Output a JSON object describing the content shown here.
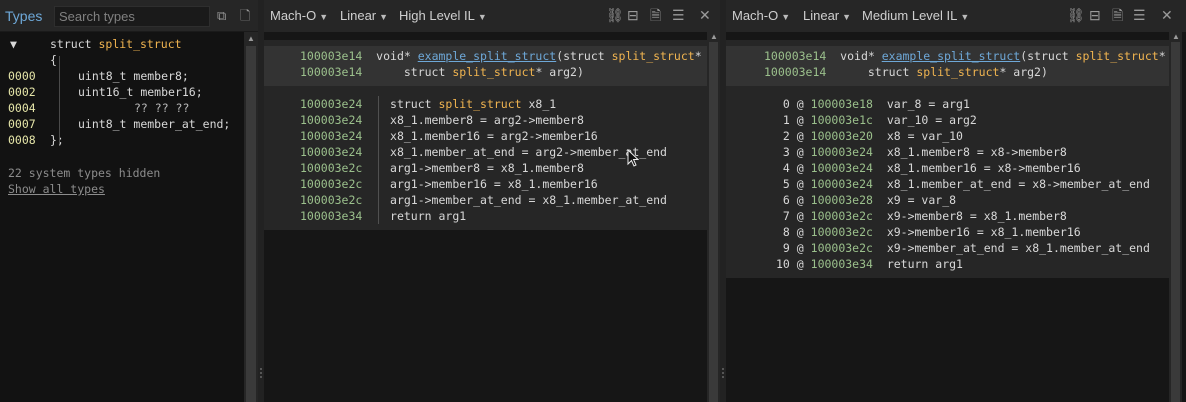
{
  "types_panel": {
    "title": "Types",
    "search_placeholder": "Search types",
    "struct_header": "struct split_struct",
    "struct_keyword": "struct ",
    "struct_name": "split_struct",
    "open_brace": "{",
    "close_brace": "};",
    "members": [
      {
        "offset": "0000",
        "type": "uint8_t",
        "name": "member8;"
      },
      {
        "offset": "0002",
        "type": "uint16_t",
        "name": "member16;"
      },
      {
        "offset": "0004",
        "type": "",
        "name": "?? ?? ??"
      },
      {
        "offset": "0007",
        "type": "uint8_t",
        "name": "member_at_end;"
      },
      {
        "offset": "0008",
        "type": "",
        "name": ""
      }
    ],
    "hidden_text": "22 system types hidden",
    "show_all_label": "Show all types"
  },
  "left_pane": {
    "view_type": "Mach-O",
    "layout": "Linear",
    "il_level": "High Level IL",
    "signature": {
      "addr": "100003e14",
      "ret": "void* ",
      "fn_name": "example_split_struct",
      "param1_pre": "(struct ",
      "param1_type": "split_struct",
      "param1_post": "*",
      "addr2": "100003e14",
      "param2_pre": "    struct ",
      "param2_type": "split_struct",
      "param2_post": "* arg2)"
    },
    "lines": [
      {
        "addr": "100003e24",
        "code": "struct ",
        "type": "split_struct",
        "rest": " x8_1"
      },
      {
        "addr": "100003e24",
        "code": "x8_1.member8 = arg2->member8",
        "type": "",
        "rest": ""
      },
      {
        "addr": "100003e24",
        "code": "x8_1.member16 = arg2->member16",
        "type": "",
        "rest": ""
      },
      {
        "addr": "100003e24",
        "code": "x8_1.member_at_end = arg2->member_at_end",
        "type": "",
        "rest": ""
      },
      {
        "addr": "100003e2c",
        "code": "arg1->member8 = x8_1.member8",
        "type": "",
        "rest": ""
      },
      {
        "addr": "100003e2c",
        "code": "arg1->member16 = x8_1.member16",
        "type": "",
        "rest": ""
      },
      {
        "addr": "100003e2c",
        "code": "arg1->member_at_end = x8_1.member_at_end",
        "type": "",
        "rest": ""
      },
      {
        "addr": "100003e34",
        "code": "return arg1",
        "type": "",
        "rest": ""
      }
    ]
  },
  "right_pane": {
    "view_type": "Mach-O",
    "layout": "Linear",
    "il_level": "Medium Level IL",
    "signature": {
      "addr": "100003e14",
      "ret": "void* ",
      "fn_name": "example_split_struct",
      "param1_pre": "(struct ",
      "param1_type": "split_struct",
      "param1_post": "*",
      "addr2": "100003e14",
      "param2_pre": "    struct ",
      "param2_type": "split_struct",
      "param2_post": "* arg2)"
    },
    "lines": [
      {
        "idx": " 0",
        "addr": "100003e18",
        "code": "var_8 = arg1"
      },
      {
        "idx": " 1",
        "addr": "100003e1c",
        "code": "var_10 = arg2"
      },
      {
        "idx": " 2",
        "addr": "100003e20",
        "code": "x8 = var_10"
      },
      {
        "idx": " 3",
        "addr": "100003e24",
        "code": "x8_1.member8 = x8->member8"
      },
      {
        "idx": " 4",
        "addr": "100003e24",
        "code": "x8_1.member16 = x8->member16"
      },
      {
        "idx": " 5",
        "addr": "100003e24",
        "code": "x8_1.member_at_end = x8->member_at_end"
      },
      {
        "idx": " 6",
        "addr": "100003e28",
        "code": "x9 = var_8"
      },
      {
        "idx": " 7",
        "addr": "100003e2c",
        "code": "x9->member8 = x8_1.member8"
      },
      {
        "idx": " 8",
        "addr": "100003e2c",
        "code": "x9->member16 = x8_1.member16"
      },
      {
        "idx": " 9",
        "addr": "100003e2c",
        "code": "x9->member_at_end = x8_1.member_at_end"
      },
      {
        "idx": "10",
        "addr": "100003e34",
        "code": "return arg1"
      }
    ]
  },
  "colors": {
    "accent_blue": "#6ea8d8",
    "type_orange": "#f0b450",
    "address_green": "#9bc08c",
    "background": "#161616"
  }
}
